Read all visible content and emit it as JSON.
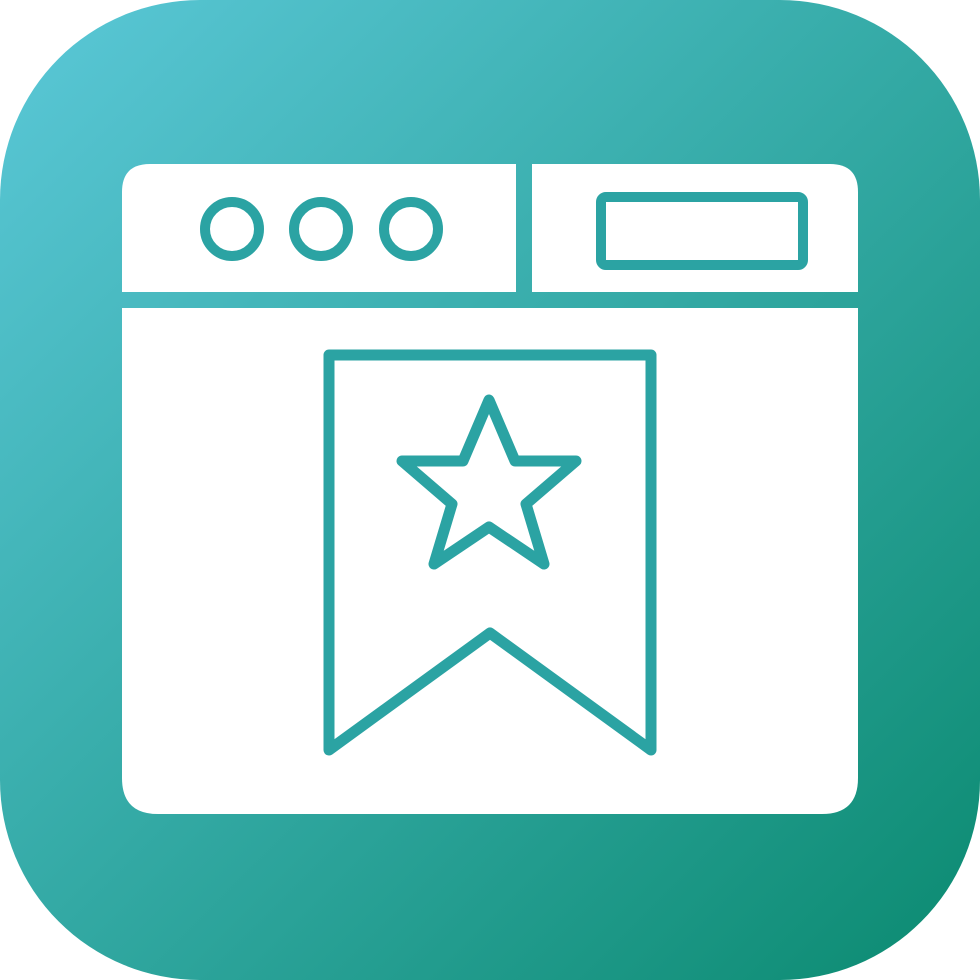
{
  "icon": {
    "name": "browser-bookmark-icon",
    "parts": [
      "rounded-square-tile",
      "browser-window",
      "window-control-dots",
      "address-bar",
      "bookmark-ribbon",
      "star"
    ]
  },
  "colors": {
    "gradient_start": "#5BC8D8",
    "gradient_end": "#0B8A70",
    "stroke": "#2BA3A3",
    "fill": "#FFFFFF"
  }
}
